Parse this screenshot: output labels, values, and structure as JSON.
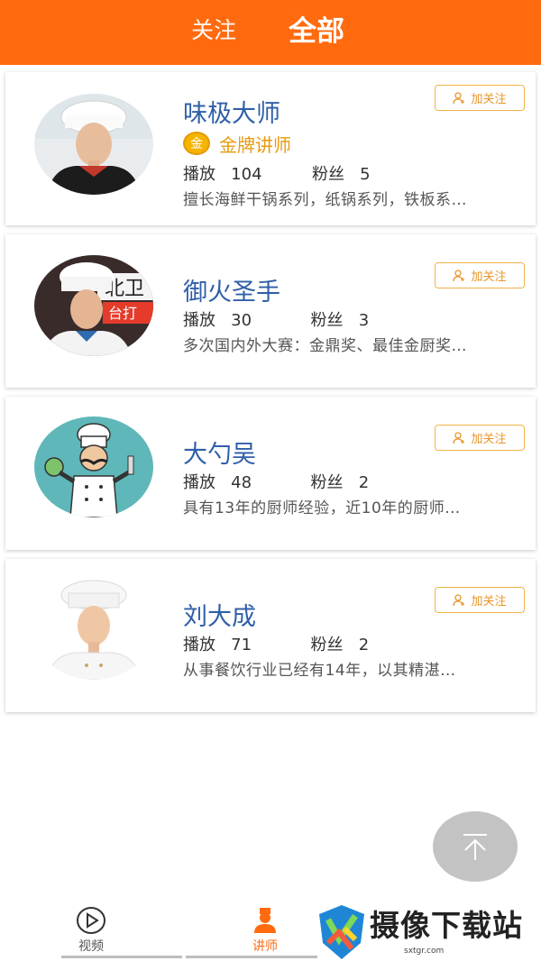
{
  "header": {
    "tab_follow": "关注",
    "tab_all": "全部"
  },
  "colors": {
    "accent": "#ff6a0f",
    "name": "#2f5fa8",
    "gold": "#e89a10"
  },
  "lecturers": [
    {
      "name": "味极大师",
      "badge": "金牌讲师",
      "badge_icon": "金",
      "play_label": "播放",
      "plays": "104",
      "fans_label": "粉丝",
      "fans": "5",
      "desc": "擅长海鲜干锅系列，纸锅系列，铁板系…",
      "follow_label": "加关注"
    },
    {
      "name": "御火圣手",
      "badge": "",
      "play_label": "播放",
      "plays": "30",
      "fans_label": "粉丝",
      "fans": "3",
      "desc": "多次国内外大赛：金鼎奖、最佳金厨奖…",
      "follow_label": "加关注"
    },
    {
      "name": "大勺吴",
      "badge": "",
      "play_label": "播放",
      "plays": "48",
      "fans_label": "粉丝",
      "fans": "2",
      "desc": "具有13年的厨师经验，近10年的厨师…",
      "follow_label": "加关注"
    },
    {
      "name": "刘大成",
      "badge": "",
      "play_label": "播放",
      "plays": "71",
      "fans_label": "粉丝",
      "fans": "2",
      "desc": "从事餐饮行业已经有14年，以其精湛…",
      "follow_label": "加关注"
    }
  ],
  "bottom_nav": {
    "video": "视频",
    "lecturer": "讲师"
  },
  "watermark": {
    "text": "摄像下载站",
    "url": "sxtgr.com"
  }
}
